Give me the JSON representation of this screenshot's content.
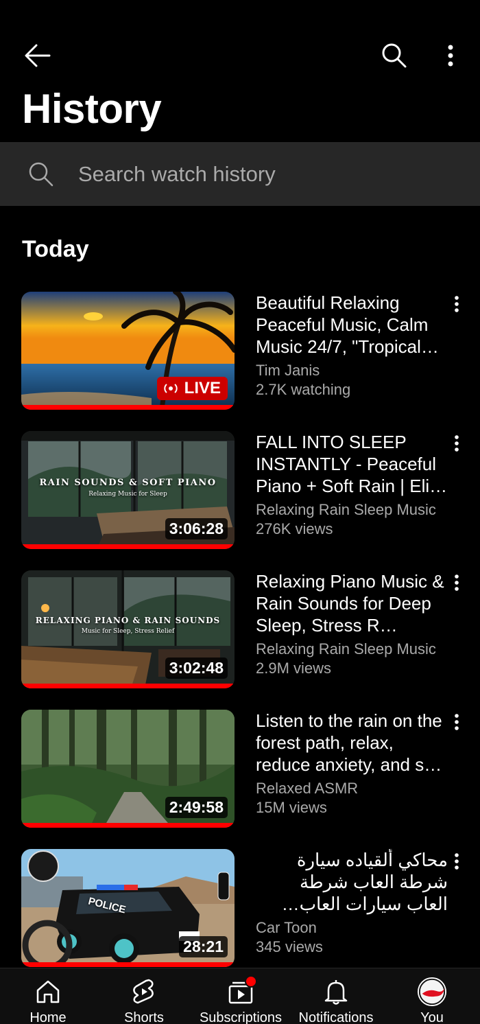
{
  "header": {
    "back_icon": "arrow-left-icon",
    "search_icon": "search-icon",
    "more_icon": "more-vertical-icon",
    "title": "History"
  },
  "search": {
    "placeholder": "Search watch history",
    "value": ""
  },
  "section": {
    "label": "Today"
  },
  "videos": [
    {
      "title": "Beautiful Relaxing Peaceful Music, Calm Music 24/7, \"Tropical…",
      "channel": "Tim Janis",
      "stats": "2.7K watching",
      "badge": "LIVE",
      "watched_fraction": 1.0
    },
    {
      "title": "FALL INTO SLEEP INSTANTLY - Peaceful Piano + Soft Rain | Eli…",
      "channel": "Relaxing Rain Sleep Music",
      "stats": "276K views",
      "duration": "3:06:28",
      "overlay_title": "RAIN SOUNDS & SOFT PIANO",
      "overlay_subtitle": "Relaxing Music for Sleep",
      "watched_fraction": 1.0
    },
    {
      "title": "Relaxing Piano Music & Rain Sounds for Deep Sleep, Stress R…",
      "channel": "Relaxing Rain Sleep Music",
      "stats": "2.9M views",
      "duration": "3:02:48",
      "overlay_title": "RELAXING PIANO & RAIN SOUNDS",
      "overlay_subtitle": "Music for Sleep, Stress Relief",
      "watched_fraction": 1.0
    },
    {
      "title": "Listen to the rain on the forest path, relax, reduce anxiety, and s…",
      "channel": "Relaxed ASMR",
      "stats": "15M views",
      "duration": "2:49:58",
      "watched_fraction": 1.0
    },
    {
      "title": "محاكي ألقياده سيارة شرطة العاب شرطة العاب سيارات العاب اندرويد Android G…",
      "channel": "Car Toon",
      "stats": "345 views",
      "duration": "28:21",
      "overlay_title": "POLICE",
      "watched_fraction": 1.0
    }
  ],
  "bottom_nav": [
    {
      "label": "Home",
      "icon": "home-icon"
    },
    {
      "label": "Shorts",
      "icon": "shorts-icon"
    },
    {
      "label": "Subscriptions",
      "icon": "subscriptions-icon"
    },
    {
      "label": "Notifications",
      "icon": "bell-icon"
    },
    {
      "label": "You",
      "icon": "avatar"
    }
  ],
  "colors": {
    "background": "#000000",
    "accent_red": "#ff0000",
    "search_bg": "#272727",
    "secondary_text": "#aaaaaa"
  }
}
